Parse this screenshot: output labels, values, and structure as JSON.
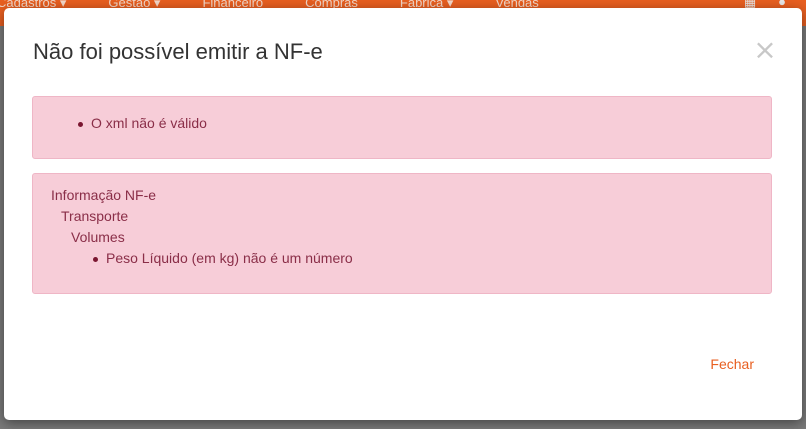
{
  "background_nav": {
    "items": [
      "Cadastros ▾",
      "Gestão ▾",
      "Financeiro",
      "Compras",
      "Fábrica ▾",
      "Vendas"
    ]
  },
  "modal": {
    "title": "Não foi possível emitir a NF-e",
    "close_symbol": "×",
    "errors": [
      {
        "message": "O xml não é válido"
      }
    ],
    "details": {
      "section": "Informação NF-e",
      "subsection": "Transporte",
      "group": "Volumes",
      "message": "Peso Líquido (em kg) não é um número"
    },
    "close_button_label": "Fechar"
  },
  "colors": {
    "accent": "#e85f20",
    "alert_bg": "#f7cdd8",
    "alert_text": "#8a2e48"
  }
}
